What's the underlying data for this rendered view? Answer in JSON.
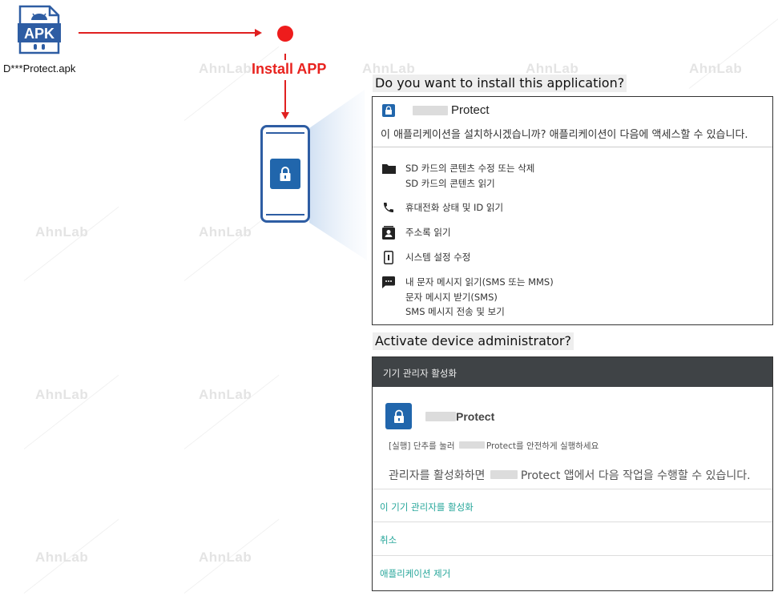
{
  "watermark_text": "AhnLab",
  "apk": {
    "badge": "APK",
    "filename": "D***Protect.apk"
  },
  "flow": {
    "install_label": "Install APP"
  },
  "install_dialog": {
    "section_title": "Do you want to install this application?",
    "app_name": "Protect",
    "question": "이 애플리케이션을 설치하시겠습니까? 애플리케이션이 다음에 액세스할 수 있습니다.",
    "permissions": [
      {
        "icon": "folder-icon",
        "lines": [
          "SD 카드의 콘텐츠 수정 또는 삭제",
          "SD 카드의 콘텐츠 읽기"
        ]
      },
      {
        "icon": "phone-icon",
        "lines": [
          "휴대전화 상태 및 ID 읽기"
        ]
      },
      {
        "icon": "contacts-icon",
        "lines": [
          "주소록 읽기"
        ]
      },
      {
        "icon": "device-settings-icon",
        "lines": [
          "시스템 설정 수정"
        ]
      },
      {
        "icon": "sms-icon",
        "lines": [
          "내 문자 메시지 읽기(SMS 또는 MMS)",
          "문자 메시지 받기(SMS)",
          "SMS 메시지 전송 및 보기"
        ]
      }
    ]
  },
  "admin_dialog": {
    "section_title": "Activate device administrator?",
    "bar_title": "기기 관리자 활성화",
    "app_name": "Protect",
    "hint_prefix": "[실행] 단추를 눌러",
    "hint_suffix": "Protect를 안전하게 실행하세요",
    "desc_prefix": "관리자를 활성화하면",
    "desc_suffix": "Protect 앱에서 다음 작업을 수행할 수 있습니다.",
    "actions": [
      "이 기기 관리자를 활성화",
      "취소",
      "애플리케이션 제거"
    ]
  },
  "colors": {
    "arrow": "#e02020",
    "accent_blue": "#2166ac",
    "teal_link": "#26a69a",
    "admin_bar": "#3f4346"
  }
}
